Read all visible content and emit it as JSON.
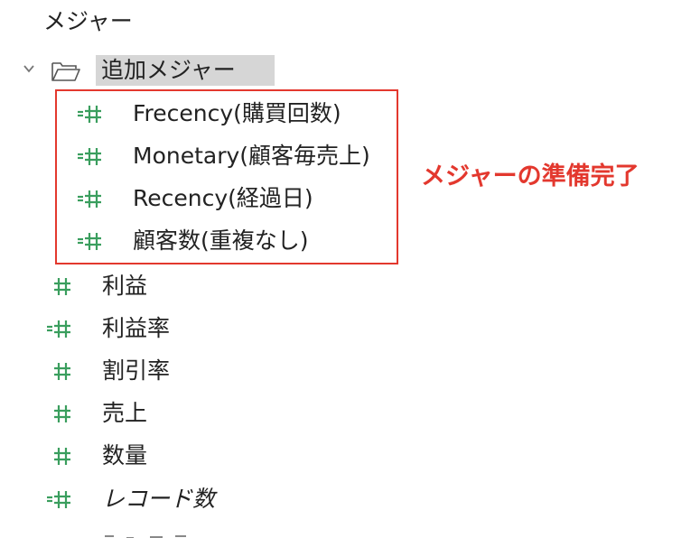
{
  "panel": {
    "section_title": "メジャー",
    "folder": {
      "label": "追加メジャー",
      "expanded": true,
      "items": [
        {
          "label": "Frecency(購買回数)",
          "icon": "calculated-measure-icon"
        },
        {
          "label": "Monetary(顧客毎売上)",
          "icon": "calculated-measure-icon"
        },
        {
          "label": "Recency(経過日)",
          "icon": "calculated-measure-icon"
        },
        {
          "label": "顧客数(重複なし)",
          "icon": "calculated-measure-icon"
        }
      ]
    },
    "measures": [
      {
        "label": "利益",
        "icon": "measure-icon"
      },
      {
        "label": "利益率",
        "icon": "calculated-measure-icon"
      },
      {
        "label": "割引率",
        "icon": "measure-icon"
      },
      {
        "label": "売上",
        "icon": "measure-icon"
      },
      {
        "label": "数量",
        "icon": "measure-icon"
      },
      {
        "label": "レコード数",
        "icon": "calculated-measure-icon",
        "italic": true
      }
    ]
  },
  "annotation": {
    "text": "メジャーの準備完了",
    "color": "#e3382e"
  },
  "colors": {
    "measure_icon": "#3a9e5e",
    "selection_background": "#d6d6d6",
    "highlight_border": "#e3382e"
  }
}
